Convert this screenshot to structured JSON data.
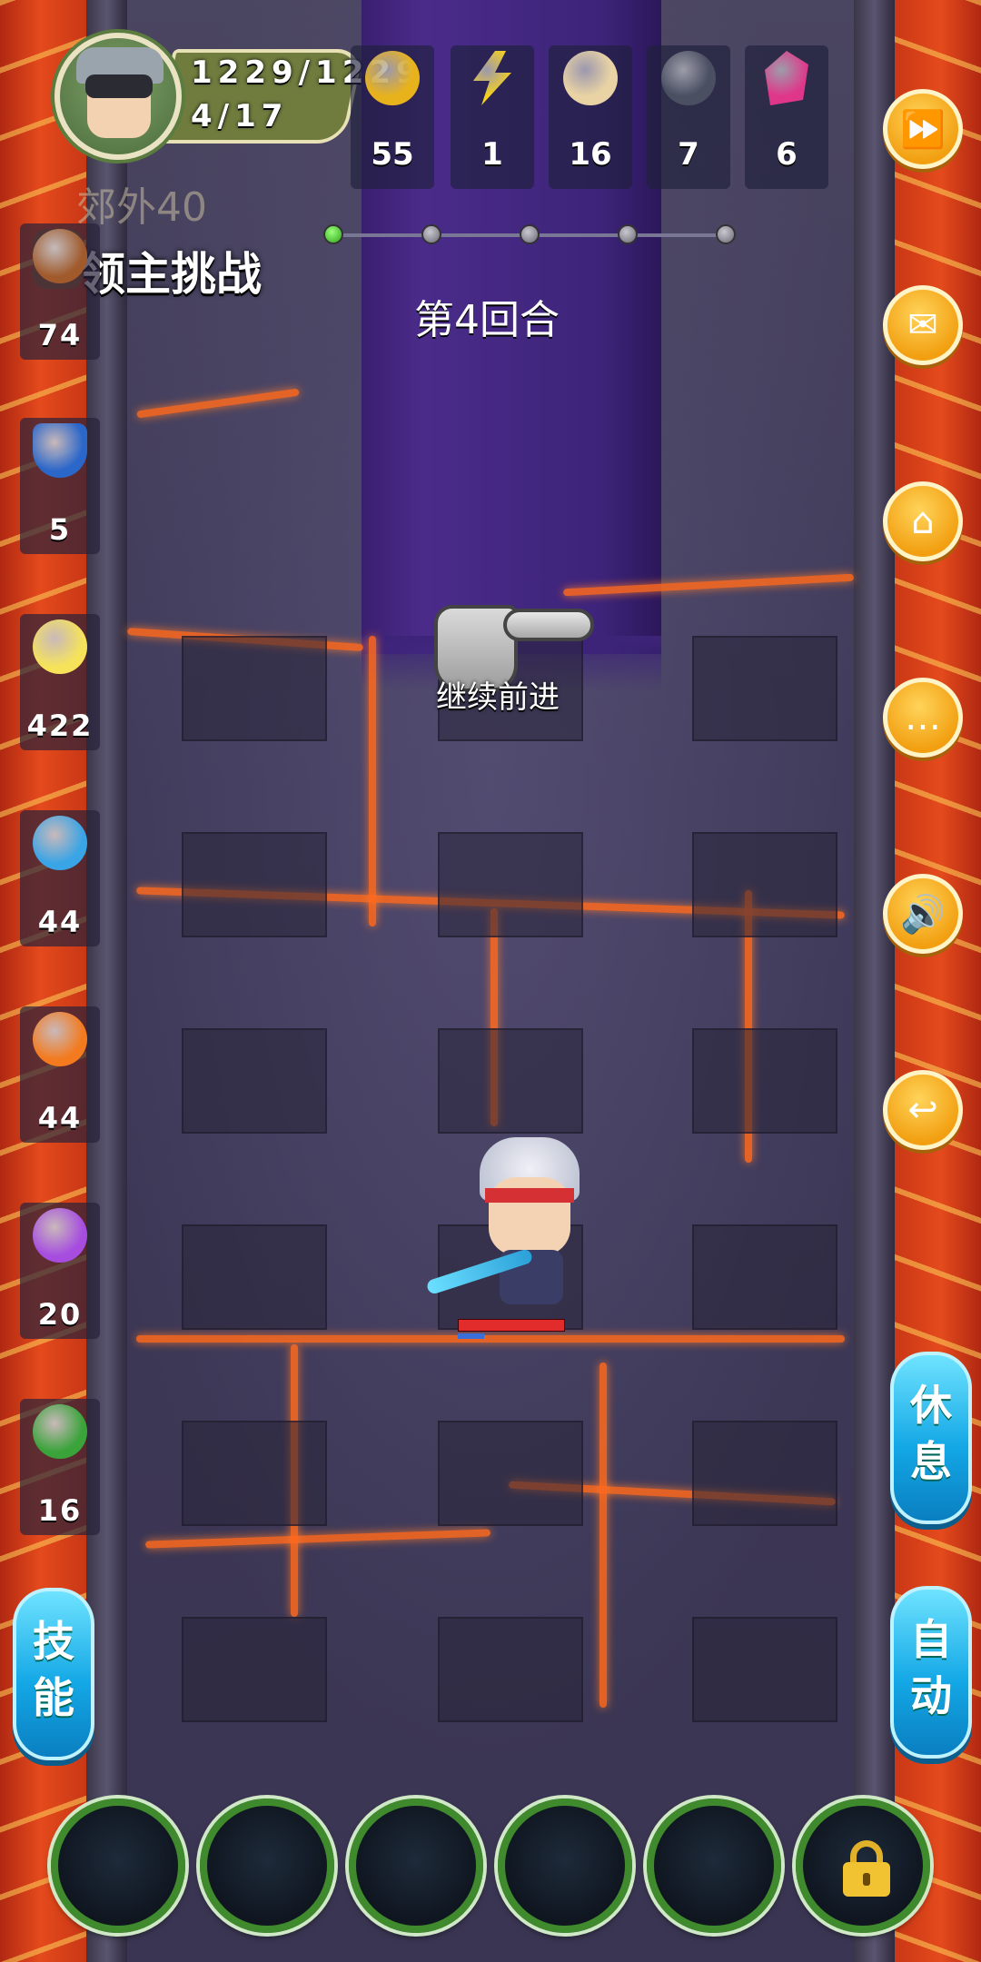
{
  "player": {
    "hp": "1229/1229",
    "stage": "4/17"
  },
  "resources": [
    {
      "name": "coin-icon",
      "value": "55",
      "color": "#e8b21c"
    },
    {
      "name": "lightning-icon",
      "value": "1",
      "color": "#f7d21a"
    },
    {
      "name": "bun-icon",
      "value": "16",
      "color": "#e9d3a4"
    },
    {
      "name": "ore-icon",
      "value": "7",
      "color": "#4a4f62"
    },
    {
      "name": "crystal-icon",
      "value": "6",
      "color": "#e0368a"
    }
  ],
  "location": "郊外40",
  "boss_title": "领主挑战",
  "progress": {
    "total": 5,
    "current": 1
  },
  "round": "第4回合",
  "continue_label": "继续前进",
  "stats": [
    {
      "name": "attack-fist-icon",
      "value": "74",
      "color": "#a05a2c"
    },
    {
      "name": "shield-icon",
      "value": "5",
      "color": "#2b66c9"
    },
    {
      "name": "light-sword-icon",
      "value": "422",
      "color": "#f6e35a"
    },
    {
      "name": "water-wave-icon",
      "value": "44",
      "color": "#39a4e6"
    },
    {
      "name": "fire-icon",
      "value": "44",
      "color": "#f37a1e"
    },
    {
      "name": "lightning-purple-icon",
      "value": "20",
      "color": "#a64de0"
    },
    {
      "name": "poison-icon",
      "value": "16",
      "color": "#3aa33a"
    }
  ],
  "side_buttons": [
    {
      "name": "fast-forward-button",
      "glyph": "⏩"
    },
    {
      "name": "mail-button",
      "glyph": "✉"
    },
    {
      "name": "home-button",
      "glyph": "⌂"
    },
    {
      "name": "chat-button",
      "glyph": "…"
    },
    {
      "name": "sound-button",
      "glyph": "🔊"
    },
    {
      "name": "back-button",
      "glyph": "↩"
    }
  ],
  "rest_label": "休\n息",
  "auto_label": "自\n动",
  "skill_label": "技\n能",
  "hero": {
    "hp_fraction": 1.0,
    "mp_fraction": 0.25
  },
  "skill_slots": 6
}
